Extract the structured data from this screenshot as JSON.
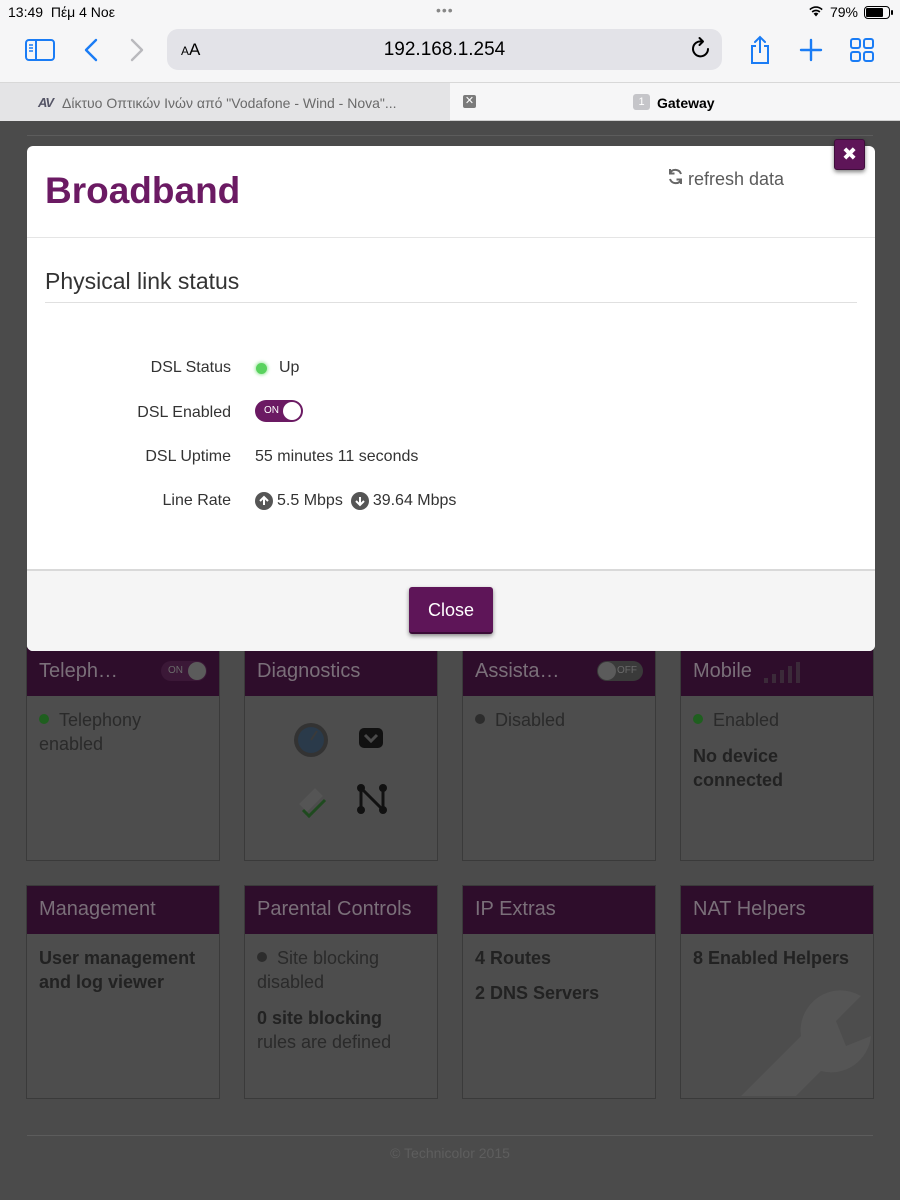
{
  "status_bar": {
    "time": "13:49",
    "date": "Πέμ 4 Νοε",
    "battery": "79%",
    "battery_level": 0.79
  },
  "browser": {
    "address": "192.168.1.254",
    "text_size_label": "AA",
    "tabs": [
      {
        "favicon": "AV",
        "title": "Δίκτυο Οπτικών Ινών από \"Vodafone - Wind - Nova\"..."
      },
      {
        "badge": "1",
        "title": "Gateway"
      }
    ]
  },
  "modal": {
    "title": "Broadband",
    "refresh_label": "refresh data",
    "section_title": "Physical link status",
    "rows": {
      "dsl_status": {
        "label": "DSL Status",
        "value": "Up"
      },
      "dsl_enabled": {
        "label": "DSL Enabled",
        "toggle": "ON"
      },
      "dsl_uptime": {
        "label": "DSL Uptime",
        "value": "55 minutes 11 seconds"
      },
      "line_rate": {
        "label": "Line Rate",
        "up": "5.5 Mbps",
        "down": "39.64 Mbps"
      }
    },
    "close_label": "Close",
    "close_icon": "✖"
  },
  "cards": {
    "telephony": {
      "title": "Teleph…",
      "toggle": "ON",
      "status": "Telephony enabled"
    },
    "diagnostics": {
      "title": "Diagnostics"
    },
    "assistance": {
      "title": "Assista…",
      "toggle": "OFF",
      "status": "Disabled"
    },
    "mobile": {
      "title": "Mobile",
      "status": "Enabled",
      "note": "No device connected"
    },
    "management": {
      "title": "Management",
      "text": "User management and log viewer"
    },
    "parental": {
      "title": "Parental Controls",
      "status": "Site blocking disabled",
      "count": "0 site blocking",
      "count_sub": "rules are defined"
    },
    "ip_extras": {
      "title": "IP Extras",
      "routes": "4 Routes",
      "dns": "2 DNS Servers"
    },
    "nat": {
      "title": "NAT Helpers",
      "text": "8 Enabled Helpers"
    }
  },
  "footer": {
    "copyright": "© Technicolor 2015"
  },
  "colors": {
    "brand": "#6b1a63",
    "status_up": "#59d25e"
  }
}
